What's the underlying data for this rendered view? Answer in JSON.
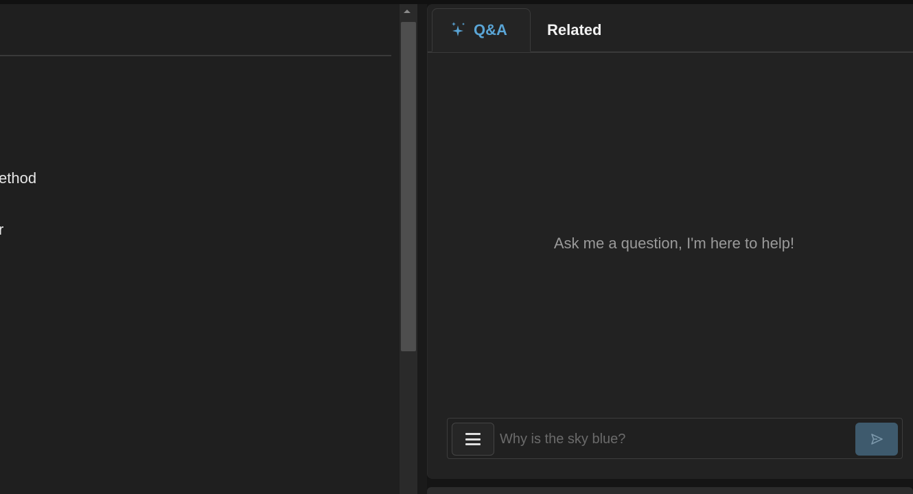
{
  "left_pane": {
    "text_line_1": "ethod",
    "text_line_2": "r"
  },
  "tabs": [
    {
      "label": "Q&A",
      "icon": "sparkle-icon",
      "active": true
    },
    {
      "label": "Related",
      "active": false
    }
  ],
  "chat": {
    "empty_message": "Ask me a question, I'm here to help!",
    "input_placeholder": "Why is the sky blue?",
    "menu_icon": "menu-icon",
    "send_icon": "send-icon"
  },
  "colors": {
    "accent": "#5aa5d6",
    "send_button": "#3e5a6d",
    "panel_bg": "#222222"
  }
}
